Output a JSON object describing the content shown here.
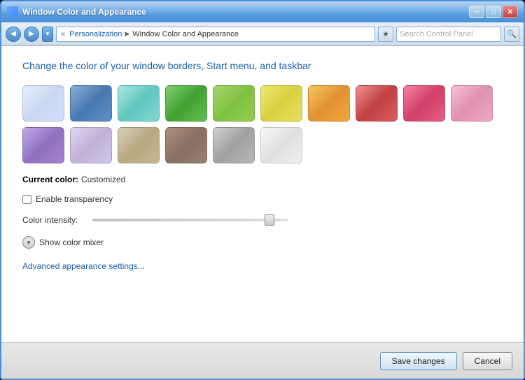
{
  "window": {
    "title": "Window Color and Appearance",
    "titlebar_buttons": {
      "minimize": "─",
      "maximize": "□",
      "close": "✕"
    }
  },
  "addressbar": {
    "back_tooltip": "Back",
    "forward_tooltip": "Forward",
    "dropdown_tooltip": "Recent",
    "breadcrumb": {
      "separator": "«",
      "parent": "Personalization",
      "current": "Window Color and Appearance"
    },
    "pin_label": "★",
    "search_placeholder": "Search Control Panel",
    "search_icon": "🔍"
  },
  "content": {
    "page_title": "Change the color of your window borders, Start menu, and taskbar",
    "current_color_label": "Current color:",
    "current_color_value": "Customized",
    "transparency_label": "Enable transparency",
    "intensity_label": "Color intensity:",
    "show_mixer_label": "Show color mixer",
    "advanced_link": "Advanced appearance settings..."
  },
  "footer": {
    "save_label": "Save changes",
    "cancel_label": "Cancel"
  }
}
